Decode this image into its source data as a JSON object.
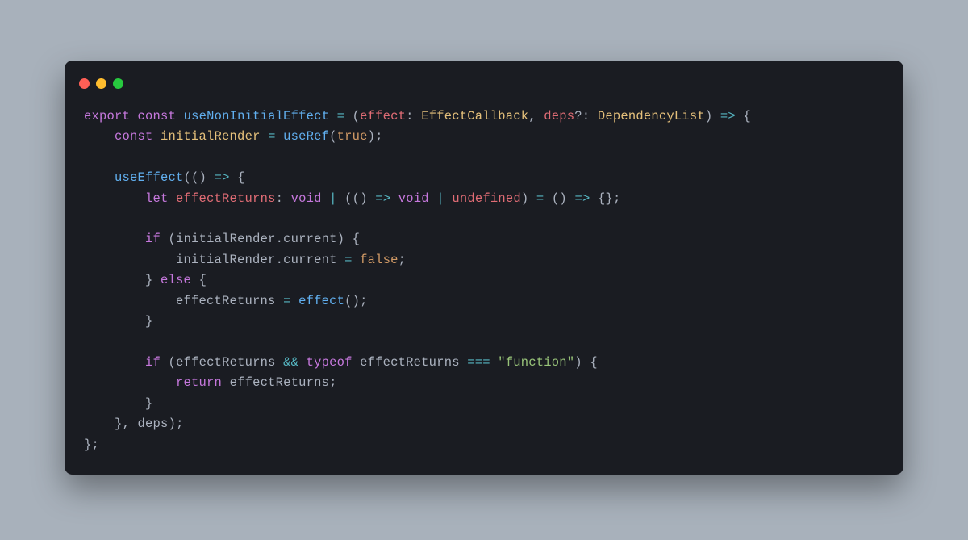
{
  "code": {
    "fnDeclared": "useNonInitialEffect",
    "paramEffect": "effect",
    "typeEffectCallback": "EffectCallback",
    "paramDeps": "deps",
    "typeDependencyList": "DependencyList",
    "constInitialRender": "initialRender",
    "useRef": "useRef",
    "true": "true",
    "useEffect": "useEffect",
    "effectReturns": "effectReturns",
    "void": "void",
    "undefined": "undefined",
    "current": "current",
    "false": "false",
    "effectCall": "effect",
    "typeof": "typeof",
    "funcStr": "\"function\"",
    "return": "return",
    "deps": "deps",
    "kwExport": "export",
    "kwConst": "const",
    "kwLet": "let",
    "kwIf": "if",
    "kwElse": "else"
  }
}
